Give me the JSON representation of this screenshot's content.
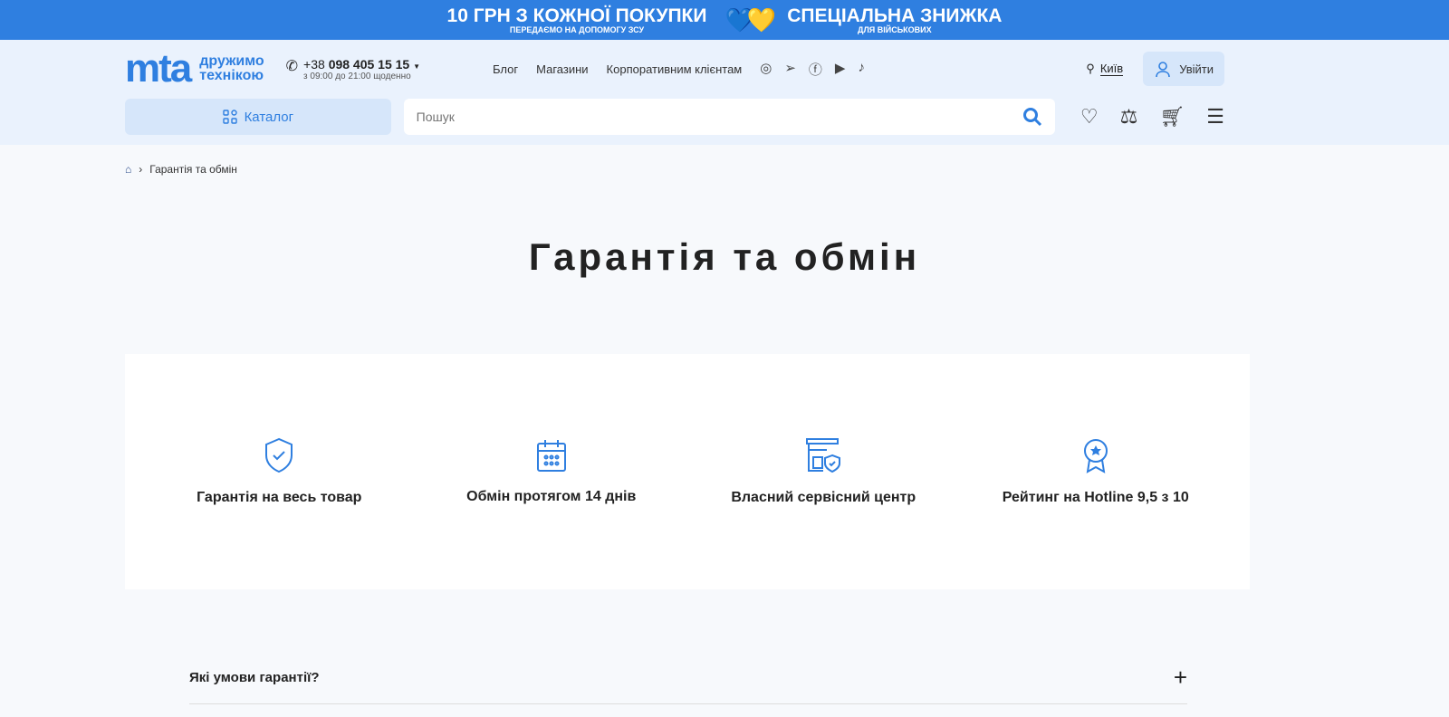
{
  "promo": {
    "left_title": "10 ГРН З КОЖНОЇ ПОКУПКИ",
    "left_sub": "ПЕРЕДАЄМО НА ДОПОМОГУ ЗСУ",
    "hearts": "💙💛",
    "right_title": "СПЕЦІАЛЬНА ЗНИЖКА",
    "right_sub": "ДЛЯ ВІЙСЬКОВИХ"
  },
  "header": {
    "logo": "mta",
    "tagline1": "дружимо",
    "tagline2": "технікою",
    "phone_prefix": "+38",
    "phone": "098 405 15 15",
    "hours": "з 09:00 до 21:00 щоденно",
    "nav": [
      "Блог",
      "Магазини",
      "Корпоративним клієнтам"
    ],
    "city": "Київ",
    "login": "Увійти",
    "catalog": "Каталог",
    "search_placeholder": "Пошук"
  },
  "breadcrumb": {
    "current": "Гарантія та обмін"
  },
  "page_title": "Гарантія та обмін",
  "features": [
    "Гарантія на весь товар",
    "Обмін протягом 14 днів",
    "Власний сервісний центр",
    "Рейтинг на Hotline 9,5 з 10"
  ],
  "faq": [
    {
      "question": "Які умови гарантії?"
    }
  ],
  "colors": {
    "accent": "#2f7fe0"
  }
}
